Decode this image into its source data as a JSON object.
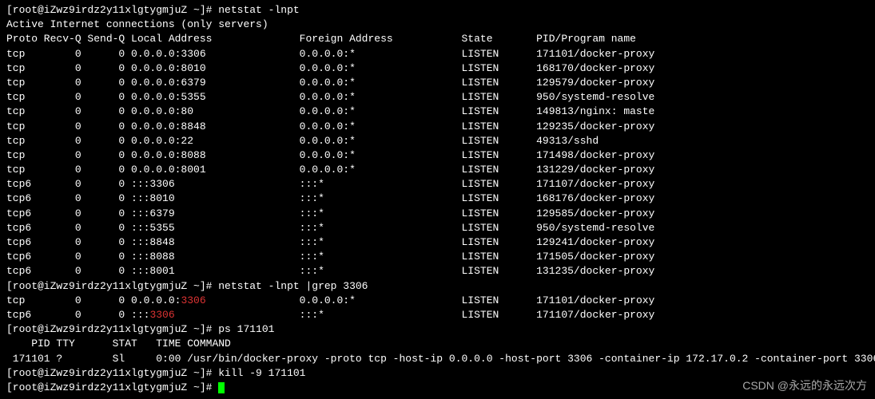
{
  "prompt": "[root@iZwz9irdz2y11xlgtygmjuZ ~]# ",
  "commands": {
    "cmd1": "netstat -lnpt",
    "cmd2": "netstat -lnpt |grep 3306",
    "cmd3": "ps 171101",
    "cmd4": "kill -9 171101"
  },
  "netstat": {
    "title": "Active Internet connections (only servers)",
    "headers": {
      "proto": "Proto",
      "recvq": "Recv-Q",
      "sendq": "Send-Q",
      "local": "Local Address",
      "foreign": "Foreign Address",
      "state": "State",
      "pid": "PID/Program name"
    },
    "rows": [
      {
        "proto": "tcp",
        "recv": "0",
        "send": "0",
        "local": "0.0.0.0:3306",
        "foreign": "0.0.0.0:*",
        "state": "LISTEN",
        "pid": "171101/docker-proxy"
      },
      {
        "proto": "tcp",
        "recv": "0",
        "send": "0",
        "local": "0.0.0.0:8010",
        "foreign": "0.0.0.0:*",
        "state": "LISTEN",
        "pid": "168170/docker-proxy"
      },
      {
        "proto": "tcp",
        "recv": "0",
        "send": "0",
        "local": "0.0.0.0:6379",
        "foreign": "0.0.0.0:*",
        "state": "LISTEN",
        "pid": "129579/docker-proxy"
      },
      {
        "proto": "tcp",
        "recv": "0",
        "send": "0",
        "local": "0.0.0.0:5355",
        "foreign": "0.0.0.0:*",
        "state": "LISTEN",
        "pid": "950/systemd-resolve"
      },
      {
        "proto": "tcp",
        "recv": "0",
        "send": "0",
        "local": "0.0.0.0:80",
        "foreign": "0.0.0.0:*",
        "state": "LISTEN",
        "pid": "149813/nginx: maste"
      },
      {
        "proto": "tcp",
        "recv": "0",
        "send": "0",
        "local": "0.0.0.0:8848",
        "foreign": "0.0.0.0:*",
        "state": "LISTEN",
        "pid": "129235/docker-proxy"
      },
      {
        "proto": "tcp",
        "recv": "0",
        "send": "0",
        "local": "0.0.0.0:22",
        "foreign": "0.0.0.0:*",
        "state": "LISTEN",
        "pid": "49313/sshd"
      },
      {
        "proto": "tcp",
        "recv": "0",
        "send": "0",
        "local": "0.0.0.0:8088",
        "foreign": "0.0.0.0:*",
        "state": "LISTEN",
        "pid": "171498/docker-proxy"
      },
      {
        "proto": "tcp",
        "recv": "0",
        "send": "0",
        "local": "0.0.0.0:8001",
        "foreign": "0.0.0.0:*",
        "state": "LISTEN",
        "pid": "131229/docker-proxy"
      },
      {
        "proto": "tcp6",
        "recv": "0",
        "send": "0",
        "local": ":::3306",
        "foreign": ":::*",
        "state": "LISTEN",
        "pid": "171107/docker-proxy"
      },
      {
        "proto": "tcp6",
        "recv": "0",
        "send": "0",
        "local": ":::8010",
        "foreign": ":::*",
        "state": "LISTEN",
        "pid": "168176/docker-proxy"
      },
      {
        "proto": "tcp6",
        "recv": "0",
        "send": "0",
        "local": ":::6379",
        "foreign": ":::*",
        "state": "LISTEN",
        "pid": "129585/docker-proxy"
      },
      {
        "proto": "tcp6",
        "recv": "0",
        "send": "0",
        "local": ":::5355",
        "foreign": ":::*",
        "state": "LISTEN",
        "pid": "950/systemd-resolve"
      },
      {
        "proto": "tcp6",
        "recv": "0",
        "send": "0",
        "local": ":::8848",
        "foreign": ":::*",
        "state": "LISTEN",
        "pid": "129241/docker-proxy"
      },
      {
        "proto": "tcp6",
        "recv": "0",
        "send": "0",
        "local": ":::8088",
        "foreign": ":::*",
        "state": "LISTEN",
        "pid": "171505/docker-proxy"
      },
      {
        "proto": "tcp6",
        "recv": "0",
        "send": "0",
        "local": ":::8001",
        "foreign": ":::*",
        "state": "LISTEN",
        "pid": "131235/docker-proxy"
      }
    ]
  },
  "grep": {
    "rows": [
      {
        "proto": "tcp",
        "recv": "0",
        "send": "0",
        "local_pre": "0.0.0.0:",
        "local_hl": "3306",
        "foreign": "0.0.0.0:*",
        "state": "LISTEN",
        "pid": "171101/docker-proxy"
      },
      {
        "proto": "tcp6",
        "recv": "0",
        "send": "0",
        "local_pre": ":::",
        "local_hl": "3306",
        "foreign": ":::*",
        "state": "LISTEN",
        "pid": "171107/docker-proxy"
      }
    ]
  },
  "ps": {
    "header": "    PID TTY      STAT   TIME COMMAND",
    "row": " 171101 ?        Sl     0:00 /usr/bin/docker-proxy -proto tcp -host-ip 0.0.0.0 -host-port 3306 -container-ip 172.17.0.2 -container-port 3306"
  },
  "watermark": "CSDN @永远的永远次方"
}
